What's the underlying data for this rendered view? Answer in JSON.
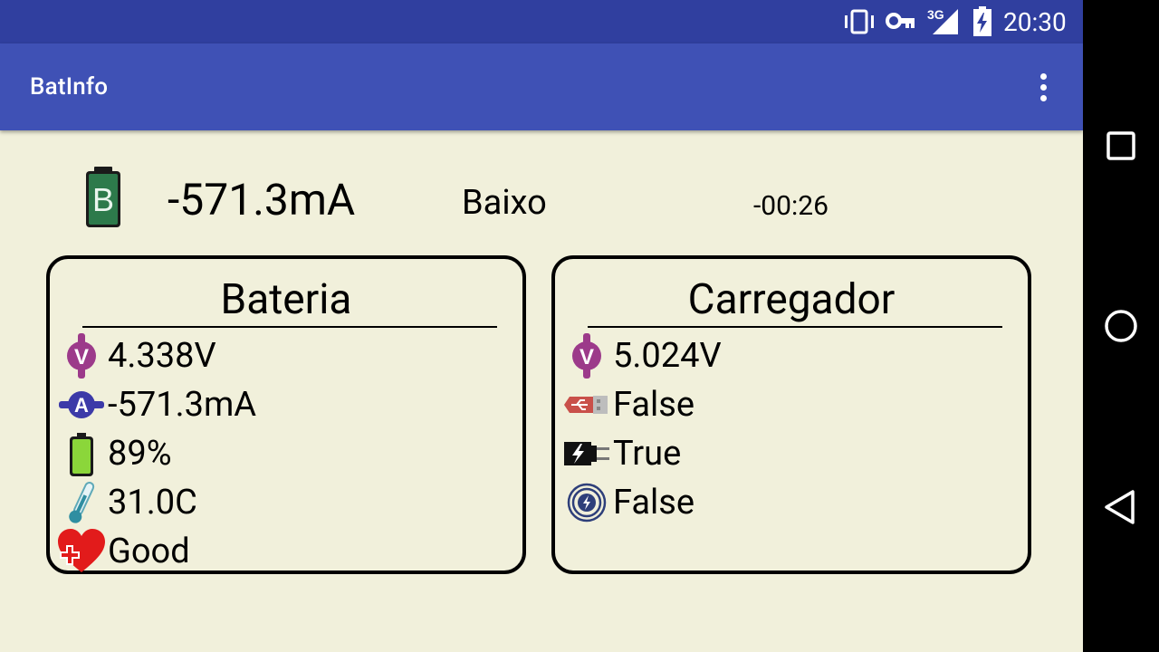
{
  "status_bar": {
    "time": "20:30",
    "network": "3G",
    "icons": [
      "vibrate-icon",
      "vpn-key-icon",
      "signal-3g-icon",
      "battery-charging-icon"
    ]
  },
  "app_bar": {
    "title": "BatInfo",
    "menu_icon": "more-vert-icon"
  },
  "summary": {
    "battery_letter": "B",
    "current": "-571.3mA",
    "level": "Baixo",
    "time": "-00:26"
  },
  "battery": {
    "title": "Bateria",
    "voltage": "4.338V",
    "current": "-571.3mA",
    "percent": "89%",
    "temperature": "31.0C",
    "health": "Good",
    "icons": [
      "voltage-icon",
      "ampere-icon",
      "battery-level-icon",
      "thermometer-icon",
      "health-heart-icon"
    ]
  },
  "charger": {
    "title": "Carregador",
    "voltage": "5.024V",
    "usb": "False",
    "ac": "True",
    "wireless": "False",
    "icons": [
      "voltage-icon",
      "usb-icon",
      "ac-plug-icon",
      "wireless-charging-icon"
    ]
  },
  "colors": {
    "status_bar": "#303f9f",
    "app_bar": "#3f51b5",
    "background": "#f1f0db",
    "voltage_icon": "#9c3a8a",
    "ampere_icon": "#3c3aa8",
    "battery_icon": "#8bd63a",
    "usb_icon": "#c9504a",
    "health_icon": "#e21b1b",
    "battery_dark": "#1f5b38"
  },
  "nav_bar": {
    "buttons": [
      "recents-icon",
      "home-icon",
      "back-icon"
    ]
  }
}
